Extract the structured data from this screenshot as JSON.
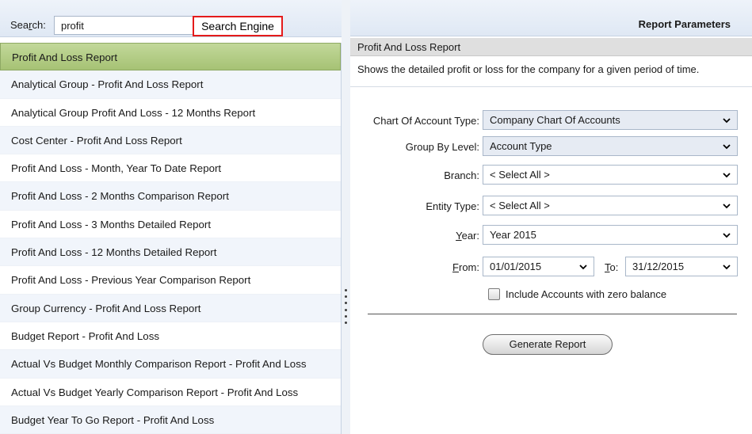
{
  "search": {
    "label_prefix": "Sea",
    "label_accel": "r",
    "label_suffix": "ch:",
    "value": "profit",
    "engine_tag": "Search Engine"
  },
  "reports": [
    {
      "label": "Profit And Loss Report",
      "selected": true
    },
    {
      "label": "Analytical Group - Profit And Loss Report"
    },
    {
      "label": "Analytical Group Profit And Loss - 12 Months Report"
    },
    {
      "label": "Cost Center - Profit And Loss Report"
    },
    {
      "label": "Profit And Loss - Month, Year To Date Report"
    },
    {
      "label": "Profit And Loss - 2 Months Comparison Report"
    },
    {
      "label": "Profit And Loss - 3 Months Detailed Report"
    },
    {
      "label": "Profit And Loss - 12 Months Detailed Report"
    },
    {
      "label": "Profit And Loss - Previous Year Comparison Report"
    },
    {
      "label": "Group Currency - Profit And Loss Report"
    },
    {
      "label": "Budget Report - Profit And Loss"
    },
    {
      "label": "Actual Vs Budget Monthly Comparison Report - Profit And Loss"
    },
    {
      "label": "Actual Vs Budget Yearly Comparison Report - Profit And Loss"
    },
    {
      "label": "Budget Year To Go Report - Profit And Loss"
    }
  ],
  "params": {
    "title": "Report Parameters",
    "report_name": "Profit And Loss Report",
    "description": "Shows the detailed profit or loss for the company for a given period of time.",
    "chart_type_label": "Chart Of Account Type:",
    "chart_type_value": "Company Chart Of Accounts",
    "group_level_label": "Group By Level:",
    "group_level_value": "Account Type",
    "branch_label": "Branch:",
    "branch_value": "< Select All >",
    "entity_label": "Entity Type:",
    "entity_value": "< Select All >",
    "year_accel": "Y",
    "year_rest": "ear:",
    "year_value": "Year 2015",
    "from_accel": "F",
    "from_rest": "rom:",
    "from_value": "01/01/2015",
    "to_accel": "T",
    "to_rest": "o:",
    "to_value": "31/12/2015",
    "zero_balance_label": "Include Accounts with zero balance",
    "generate_label": "Generate Report"
  },
  "colors": {
    "selected_row": "#b5cf88",
    "highlight_border": "#e41b1b"
  }
}
